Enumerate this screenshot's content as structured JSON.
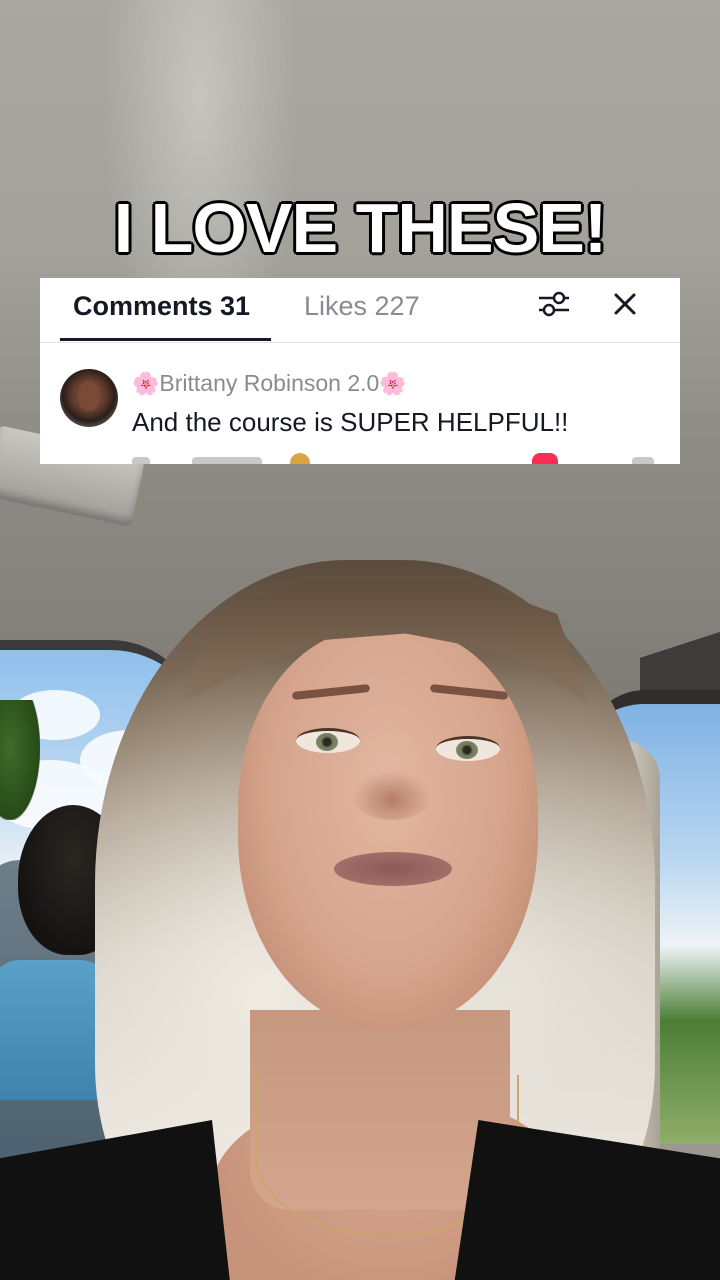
{
  "caption": {
    "text": "I LOVE THESE!"
  },
  "comment_panel": {
    "tabs": [
      {
        "label": "Comments 31",
        "active": true
      },
      {
        "label": "Likes 227",
        "active": false
      }
    ],
    "filter_icon": "sliders-icon",
    "close_icon": "close-icon",
    "comment": {
      "flower_left": "🌸",
      "username": "Brittany Robinson 2.0",
      "flower_right": "🌸",
      "text": "And the course is SUPER HELPFUL!!"
    }
  },
  "colors": {
    "panel_bg": "#ffffff",
    "active_tab": "#161823",
    "inactive_tab": "#8a8b91",
    "like_red": "#fe2c55"
  }
}
